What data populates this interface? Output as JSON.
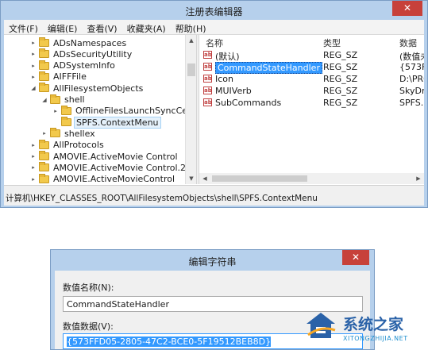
{
  "window": {
    "title": "注册表编辑器",
    "close_glyph": "✕"
  },
  "menu": [
    "文件(F)",
    "编辑(E)",
    "查看(V)",
    "收藏夹(A)",
    "帮助(H)"
  ],
  "tree": [
    {
      "label": "ADsNamespaces",
      "indent": 2,
      "expander": "▸"
    },
    {
      "label": "ADsSecurityUtility",
      "indent": 2,
      "expander": "▸"
    },
    {
      "label": "ADSystemInfo",
      "indent": 2,
      "expander": "▸"
    },
    {
      "label": "AIFFFile",
      "indent": 2,
      "expander": "▸"
    },
    {
      "label": "AllFilesystemObjects",
      "indent": 2,
      "expander": "◢"
    },
    {
      "label": "shell",
      "indent": 3,
      "expander": "◢"
    },
    {
      "label": "OfflineFilesLaunchSyncCenter",
      "indent": 4,
      "expander": "▸"
    },
    {
      "label": "SPFS.ContextMenu",
      "indent": 4,
      "expander": "",
      "selected": true
    },
    {
      "label": "shellex",
      "indent": 3,
      "expander": "▸"
    },
    {
      "label": "AllProtocols",
      "indent": 2,
      "expander": "▸"
    },
    {
      "label": "AMOVIE.ActiveMovie Control",
      "indent": 2,
      "expander": "▸"
    },
    {
      "label": "AMOVIE.ActiveMovie Control.2",
      "indent": 2,
      "expander": "▸"
    },
    {
      "label": "AMOVIE.ActiveMovieControl",
      "indent": 2,
      "expander": "▸"
    }
  ],
  "list": {
    "headers": {
      "name": "名称",
      "type": "类型",
      "data": "数据"
    },
    "rows": [
      {
        "name": "(默认)",
        "type": "REG_SZ",
        "data": "(数值未"
      },
      {
        "name": "CommandStateHandler",
        "type": "REG_SZ",
        "data": "{573FI",
        "selected": true
      },
      {
        "name": "Icon",
        "type": "REG_SZ",
        "data": "D:\\PRO"
      },
      {
        "name": "MUIVerb",
        "type": "REG_SZ",
        "data": "SkyDri"
      },
      {
        "name": "SubCommands",
        "type": "REG_SZ",
        "data": "SPFS.E"
      }
    ]
  },
  "status": "计算机\\HKEY_CLASSES_ROOT\\AllFilesystemObjects\\shell\\SPFS.ContextMenu",
  "dialog": {
    "title": "编辑字符串",
    "close_glyph": "✕",
    "name_label": "数值名称(N):",
    "name_value": "CommandStateHandler",
    "data_label": "数值数据(V):",
    "data_value": "{573FFD05-2805-47C2-BCE0-5F19512BEB8D}"
  },
  "watermark": {
    "text_cn": "系统之家",
    "text_en": "XITONGZHIJIA.NET"
  }
}
